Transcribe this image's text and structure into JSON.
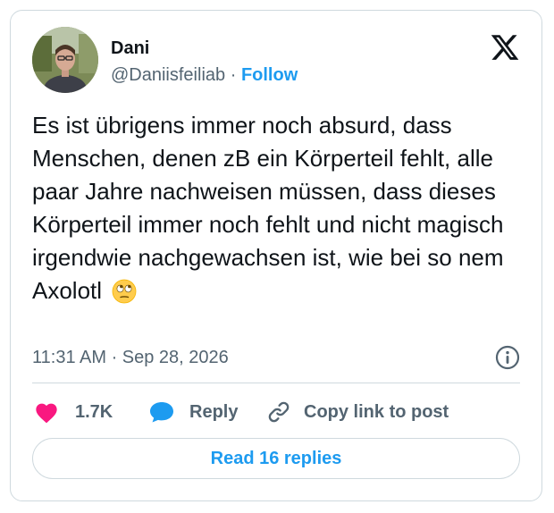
{
  "author": {
    "name": "Dani",
    "handle": "@Daniisfeiliab",
    "separator": "·",
    "follow_label": "Follow"
  },
  "tweet": {
    "text": "Es ist übrigens immer noch absurd, dass Menschen, denen zB ein Körperteil fehlt, alle paar Jahre nachweisen müssen, dass dieses Körperteil immer noch fehlt und nicht magisch irgendwie nachgewachsen ist, wie bei so nem Axolotl",
    "emoji": "face-with-rolling-eyes",
    "timestamp": "11:31 AM · Sep 28, 2026"
  },
  "actions": {
    "like_count": "1.7K",
    "reply_label": "Reply",
    "copy_label": "Copy link to post"
  },
  "read_replies_label": "Read 16 replies",
  "icons": {
    "logo": "x-logo-icon",
    "info": "info-icon",
    "like": "heart-icon",
    "reply": "speech-bubble-icon",
    "copy": "link-icon"
  },
  "colors": {
    "accent": "#1d9bf0",
    "like": "#f91880",
    "secondary_text": "#536471",
    "border": "#cfd9de"
  }
}
